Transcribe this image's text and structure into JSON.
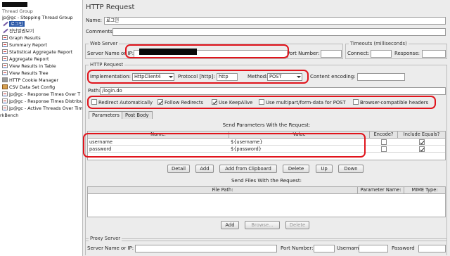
{
  "tree": {
    "items": [
      {
        "label": "Thread Group",
        "icon": "none"
      },
      {
        "label": "jp@gc - Stepping Thread Group",
        "icon": "none"
      },
      {
        "label": "로그인",
        "icon": "pencil-icon",
        "selected": true
      },
      {
        "label": "진단알권보기",
        "icon": "pencil-icon"
      },
      {
        "label": "Graph Results",
        "icon": "chart-icon"
      },
      {
        "label": "Summary Report",
        "icon": "chart-icon"
      },
      {
        "label": "Statistical Aggregate Report",
        "icon": "chart-icon"
      },
      {
        "label": "Aggregate Report",
        "icon": "chart-icon"
      },
      {
        "label": "View Results in Table",
        "icon": "chart-icon"
      },
      {
        "label": "View Results Tree",
        "icon": "chart-icon"
      },
      {
        "label": "HTTP Cookie Manager",
        "icon": "cookie-icon"
      },
      {
        "label": "CSV Data Set Config",
        "icon": "csv-icon"
      },
      {
        "label": "jp@gc - Response Times Over T",
        "icon": "chart-icon"
      },
      {
        "label": "jp@gc - Response Times Distribu",
        "icon": "chart-icon"
      },
      {
        "label": "jp@gc - Active Threads Over Tim",
        "icon": "chart-icon"
      },
      {
        "label": "rkBench",
        "icon": "none"
      }
    ]
  },
  "panel": {
    "title": "HTTP Request",
    "name_label": "Name:",
    "name_value": "로그인",
    "comments_label": "Comments:",
    "web_server": {
      "legend": "Web Server",
      "server_label": "Server Name or IP:",
      "port_label": "Port Number:",
      "port_value": ""
    },
    "timeouts": {
      "legend": "Timeouts (milliseconds)",
      "connect_label": "Connect:",
      "response_label": "Response:"
    },
    "http_request": {
      "legend": "HTTP Request",
      "implementation_label": "Implementation:",
      "implementation_value": "HttpClient4",
      "protocol_label": "Protocol [http]:",
      "protocol_value": "http",
      "method_label": "Method:",
      "method_value": "POST",
      "encoding_label": "Content encoding:",
      "path_label": "Path:",
      "path_value": "/login.do"
    },
    "options": [
      {
        "label": "Redirect Automatically",
        "checked": false
      },
      {
        "label": "Follow Redirects",
        "checked": true
      },
      {
        "label": "Use KeepAlive",
        "checked": true
      },
      {
        "label": "Use multipart/form-data for POST",
        "checked": false
      },
      {
        "label": "Browser-compatible headers",
        "checked": false
      }
    ],
    "tabs": [
      "Parameters",
      "Post Body"
    ],
    "params": {
      "title": "Send Parameters With the Request:",
      "headers": [
        "Name:",
        "Value",
        "Encode?",
        "Include Equals?"
      ],
      "rows": [
        {
          "name": "username",
          "value": "${username}",
          "encode": false,
          "include_equals": true
        },
        {
          "name": "password",
          "value": "${password}",
          "encode": false,
          "include_equals": true
        }
      ],
      "buttons": [
        "Detail",
        "Add",
        "Add from Clipboard",
        "Delete",
        "Up",
        "Down"
      ]
    },
    "files": {
      "title": "Send Files With the Request:",
      "headers": [
        "File Path:",
        "Parameter Name:",
        "MIME Type:"
      ],
      "buttons": [
        "Add",
        "Browse...",
        "Delete"
      ]
    },
    "proxy": {
      "legend": "Proxy Server",
      "server_label": "Server Name or IP:",
      "port_label": "Port Number:",
      "username_label": "Username",
      "password_label": "Password"
    }
  },
  "colors": {
    "highlight": "#e0141c",
    "selection": "#2d5aa8"
  }
}
